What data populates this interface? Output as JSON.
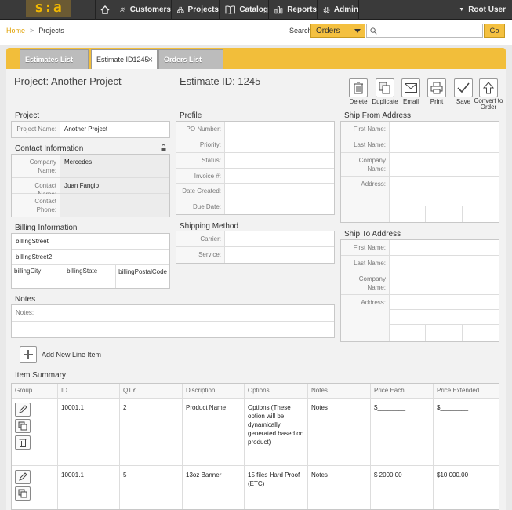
{
  "logo": "s:a",
  "nav": {
    "customers": "Customers",
    "projects": "Projects",
    "catalog": "Catalog",
    "reports": "Reports",
    "admin": "Admin",
    "user": "Root User"
  },
  "breadcrumb": {
    "home": "Home",
    "sep": ">",
    "current": "Projects"
  },
  "search": {
    "label": "Search",
    "selected": "Orders",
    "placeholder": "",
    "go": "Go"
  },
  "tabs": [
    {
      "label": "Estimates List"
    },
    {
      "label": "Estimate ID1245"
    },
    {
      "label": "Orders List"
    }
  ],
  "header": {
    "project_title": "Project: Another Project",
    "estimate_title": "Estimate ID: 1245"
  },
  "toolbar": {
    "delete": "Delete",
    "duplicate": "Duplicate",
    "email": "Email",
    "print": "Print",
    "save": "Save",
    "convert": "Convert to Order"
  },
  "project": {
    "title": "Project",
    "name_label": "Project Name:",
    "name": "Another Project"
  },
  "contact": {
    "title": "Contact Information",
    "company_label": "Company Name:",
    "company": "Mercedes",
    "contact_label": "Contact Name:",
    "contact": "Juan Fangio",
    "phone_label": "Contact Phone:",
    "phone": ""
  },
  "billing": {
    "title": "Billing Information",
    "street": "billingStreet",
    "street2": "billingStreet2",
    "city": "billingCity",
    "state": "billingState",
    "postal": "billingPostalCode"
  },
  "profile": {
    "title": "Profile",
    "po": "PO Number:",
    "priority": "Priority:",
    "status": "Status:",
    "invoice": "Invoice #:",
    "date_created": "Date Created:",
    "due_date": "Due Date:"
  },
  "shipping": {
    "title": "Shipping Method",
    "carrier": "Carrier:",
    "service": "Service:"
  },
  "ship_from": {
    "title": "Ship From Address",
    "first": "First Name:",
    "last": "Last Name:",
    "company": "Company Name:",
    "address": "Address:"
  },
  "ship_to": {
    "title": "Ship To Address",
    "first": "First Name:",
    "last": "Last Name:",
    "company": "Company Name:",
    "address": "Address:"
  },
  "notes": {
    "title": "Notes",
    "label": "Notes:"
  },
  "add_line": "Add New Line Item",
  "item_summary": {
    "title": "Item Summary",
    "columns": [
      "Group",
      "ID",
      "QTY",
      "Discription",
      "Options",
      "Notes",
      "Price Each",
      "Price Extended"
    ],
    "rows": [
      {
        "id": "10001.1",
        "qty": "2",
        "desc": "Product Name",
        "options": "Options (These option will be dynamically generated based on product)",
        "notes": "Notes",
        "price": "$________",
        "ext": "$________"
      },
      {
        "id": "10001.1",
        "qty": "5",
        "desc": "13oz Banner",
        "options": "15 files Hard Proof (ETC)",
        "notes": "Notes",
        "price": "$ 2000.00",
        "ext": "$10,000.00"
      }
    ]
  }
}
